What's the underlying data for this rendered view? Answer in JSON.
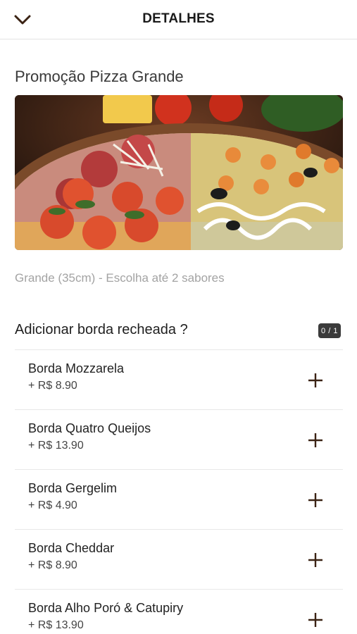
{
  "header": {
    "title": "DETALHES",
    "back_icon": "chevron-down-icon"
  },
  "product": {
    "name": "Promoção Pizza Grande",
    "description": "Grande (35cm) - Escolha até 2 sabores"
  },
  "section": {
    "title": "Adicionar borda recheada ?",
    "counter": "0 / 1"
  },
  "options": [
    {
      "name": "Borda Mozzarela",
      "price": "+ R$ 8.90"
    },
    {
      "name": "Borda Quatro Queijos",
      "price": "+ R$ 13.90"
    },
    {
      "name": "Borda Gergelim",
      "price": "+ R$ 4.90"
    },
    {
      "name": "Borda Cheddar",
      "price": "+ R$ 8.90"
    },
    {
      "name": "Borda Alho Poró & Catupiry",
      "price": "+ R$ 13.90"
    }
  ],
  "colors": {
    "accent": "#3b2314",
    "badge": "#3b3b3b"
  },
  "icons": {
    "add": "plus-icon"
  }
}
